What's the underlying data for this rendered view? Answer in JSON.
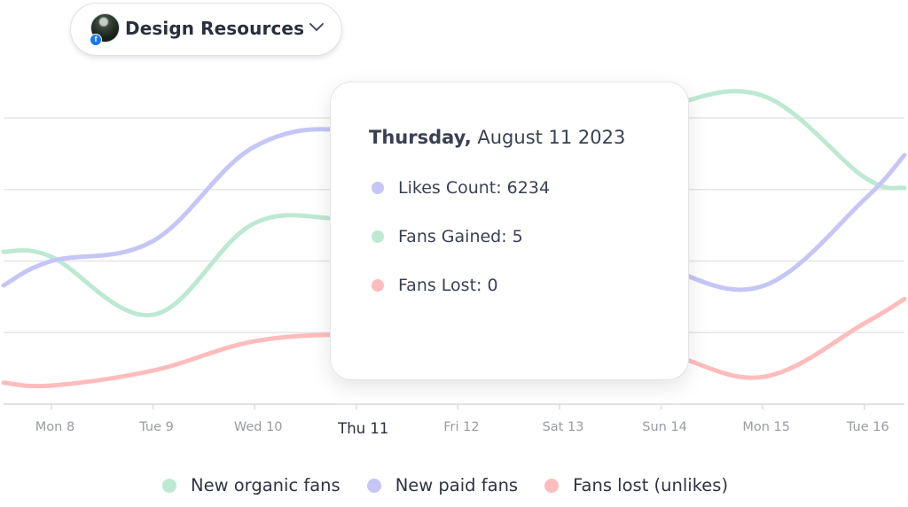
{
  "page_selector": {
    "name": "Design Resources",
    "network_badge": "f",
    "avatar_icon": "page-avatar",
    "dropdown_icon": "chevron-down-icon"
  },
  "colors": {
    "organic": "#bde9d3",
    "paid": "#c5c6f6",
    "lost": "#ffbcbc",
    "grid": "#e6e6e8",
    "text": "#3a4052",
    "tick_text": "#9a9ca4",
    "facebook": "#1877f2"
  },
  "tooltip": {
    "weekday": "Thursday,",
    "date": "August 11  2023",
    "rows": [
      {
        "label": "Likes Count: 6234",
        "series": "paid"
      },
      {
        "label": "Fans Gained: 5",
        "series": "organic"
      },
      {
        "label": "Fans Lost: 0",
        "series": "lost"
      }
    ]
  },
  "chart_data": {
    "type": "line",
    "title": "",
    "xlabel": "",
    "ylabel": "",
    "y_units": "gridline units (baseline = 0, each gridline = 1; axis values not labeled)",
    "ylim": [
      0,
      4.6
    ],
    "grid": true,
    "gridlines": [
      1,
      2,
      3,
      4
    ],
    "smooth": true,
    "categories": [
      "Mon 8",
      "Tue 9",
      "Wed 10",
      "Thu 11",
      "Fri 12",
      "Sat 13",
      "Sun 14",
      "Mon 15",
      "Tue 16"
    ],
    "highlighted_category": "Thu 11",
    "edge_values_note": "left/right are values where lines enter/leave the visible plot",
    "series": [
      {
        "name": "New organic fans",
        "key": "organic",
        "left": 2.13,
        "values": [
          2.06,
          1.25,
          2.53,
          2.61,
          2.98,
          3.67,
          4.14,
          4.31,
          3.17
        ],
        "right": 3.02
      },
      {
        "name": "New paid fans",
        "key": "paid",
        "left": 1.66,
        "values": [
          2.0,
          2.28,
          3.6,
          3.8,
          3.17,
          2.55,
          1.93,
          1.65,
          2.86
        ],
        "right": 3.48
      },
      {
        "name": "Fans lost (unlikes)",
        "key": "lost",
        "left": 0.3,
        "values": [
          0.26,
          0.47,
          0.88,
          0.98,
          0.97,
          0.88,
          0.72,
          0.38,
          1.13
        ],
        "right": 1.47
      }
    ],
    "legend": {
      "placement": "bottom-center",
      "entries": [
        {
          "label": "New organic fans",
          "key": "organic"
        },
        {
          "label": "New paid fans",
          "key": "paid"
        },
        {
          "label": "Fans lost (unlikes)",
          "key": "lost"
        }
      ]
    }
  }
}
